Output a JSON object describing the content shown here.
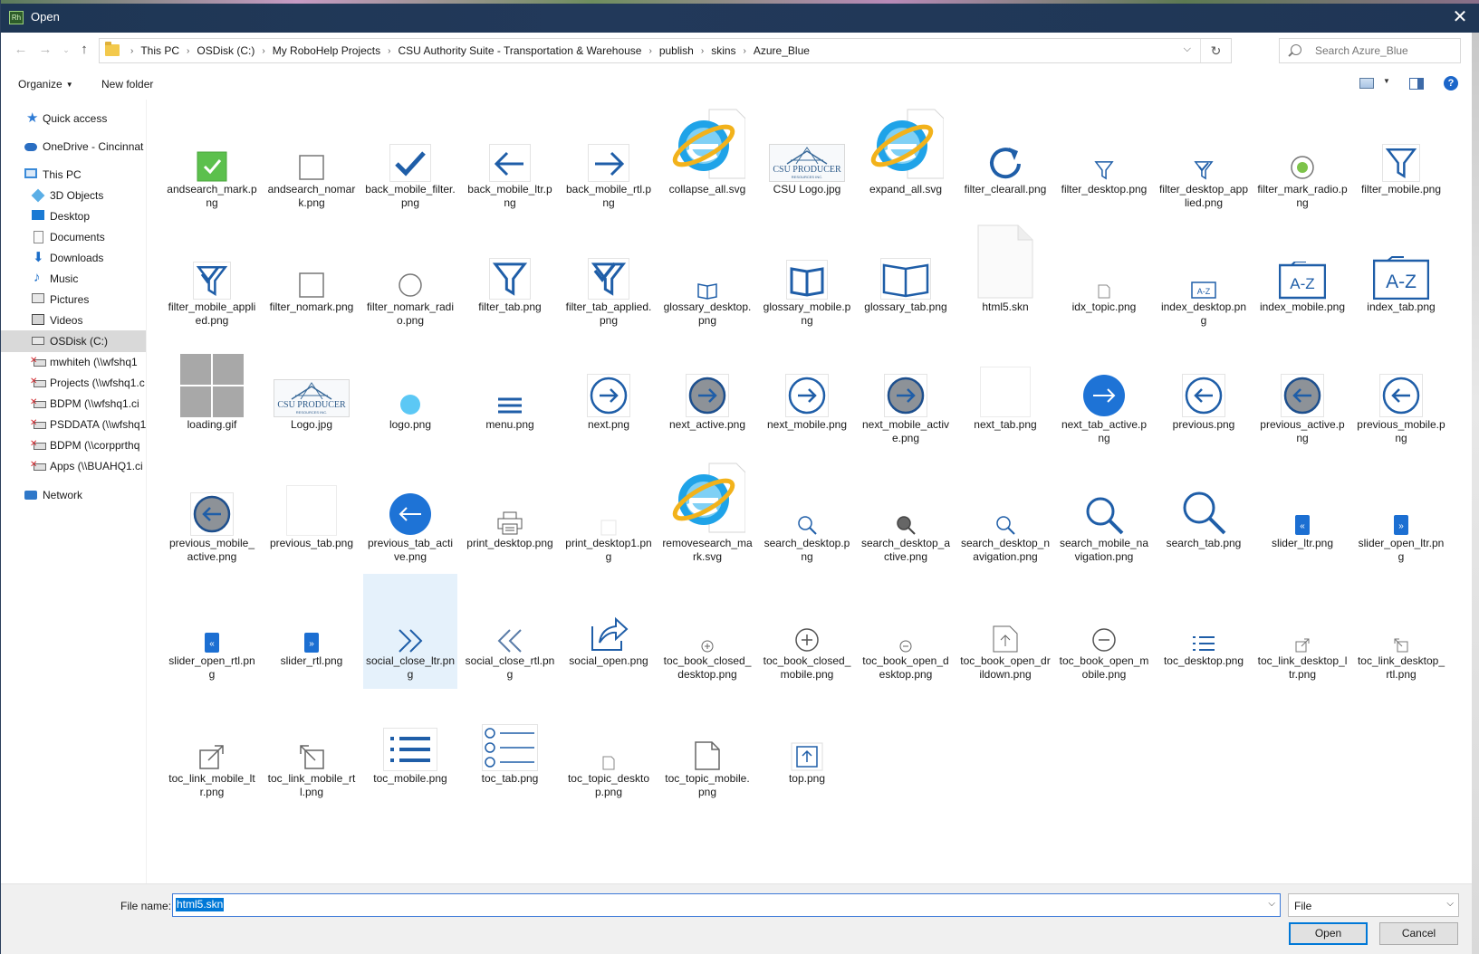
{
  "window": {
    "title": "Open",
    "app_icon_text": "Rh",
    "close_label": "✕"
  },
  "address": {
    "crumbs": [
      "This PC",
      "OSDisk (C:)",
      "My RoboHelp Projects",
      "CSU Authority Suite - Transportation & Warehouse",
      "publish",
      "skins",
      "Azure_Blue"
    ]
  },
  "search": {
    "placeholder": "Search Azure_Blue"
  },
  "toolbar": {
    "organize": "Organize",
    "new_folder": "New folder",
    "help": "?"
  },
  "nav": {
    "items": [
      {
        "label": "Quick access",
        "icon": "star-icon"
      },
      {
        "label": "OneDrive - Cincinnat",
        "icon": "cloud-icon"
      },
      {
        "label": "This PC",
        "icon": "computer-icon"
      },
      {
        "label": "3D Objects",
        "icon": "cube-icon"
      },
      {
        "label": "Desktop",
        "icon": "desktop-icon"
      },
      {
        "label": "Documents",
        "icon": "documents-icon"
      },
      {
        "label": "Downloads",
        "icon": "download-icon"
      },
      {
        "label": "Music",
        "icon": "music-icon"
      },
      {
        "label": "Pictures",
        "icon": "pictures-icon"
      },
      {
        "label": "Videos",
        "icon": "videos-icon"
      },
      {
        "label": "OSDisk (C:)",
        "icon": "drive-icon"
      },
      {
        "label": "mwhiteh (\\\\wfshq1",
        "icon": "network-drive-icon"
      },
      {
        "label": "Projects (\\\\wfshq1.c",
        "icon": "network-drive-icon"
      },
      {
        "label": "BDPM (\\\\wfshq1.ci",
        "icon": "network-drive-icon"
      },
      {
        "label": "PSDDATA (\\\\wfshq1",
        "icon": "network-drive-icon"
      },
      {
        "label": "BDPM (\\\\corpprthq",
        "icon": "network-drive-icon"
      },
      {
        "label": "Apps (\\\\BUAHQ1.ci",
        "icon": "network-drive-icon"
      },
      {
        "label": "Network",
        "icon": "network-icon"
      }
    ],
    "selected": "OSDisk (C:)"
  },
  "files": [
    {
      "name": "andsearch_mark.png",
      "icon": "green-check-box"
    },
    {
      "name": "andsearch_nomark.png",
      "icon": "empty-box"
    },
    {
      "name": "back_mobile_filter.png",
      "icon": "checkmark"
    },
    {
      "name": "back_mobile_ltr.png",
      "icon": "arrow-left"
    },
    {
      "name": "back_mobile_rtl.png",
      "icon": "arrow-right"
    },
    {
      "name": "collapse_all.svg",
      "icon": "ie-logo"
    },
    {
      "name": "CSU Logo.jpg",
      "icon": "csu-logo"
    },
    {
      "name": "expand_all.svg",
      "icon": "ie-logo"
    },
    {
      "name": "filter_clearall.png",
      "icon": "refresh"
    },
    {
      "name": "filter_desktop.png",
      "icon": "funnel-small"
    },
    {
      "name": "filter_desktop_applied.png",
      "icon": "funnel-check-small"
    },
    {
      "name": "filter_mark_radio.png",
      "icon": "radio-on"
    },
    {
      "name": "filter_mobile.png",
      "icon": "funnel"
    },
    {
      "name": "filter_mobile_applied.png",
      "icon": "funnel-check"
    },
    {
      "name": "filter_nomark.png",
      "icon": "empty-box"
    },
    {
      "name": "filter_nomark_radio.png",
      "icon": "radio-off"
    },
    {
      "name": "filter_tab.png",
      "icon": "funnel-large"
    },
    {
      "name": "filter_tab_applied.png",
      "icon": "funnel-check-large"
    },
    {
      "name": "glossary_desktop.png",
      "icon": "book-small"
    },
    {
      "name": "glossary_mobile.png",
      "icon": "book"
    },
    {
      "name": "glossary_tab.png",
      "icon": "book-large"
    },
    {
      "name": "html5.skn",
      "icon": "blank-doc"
    },
    {
      "name": "idx_topic.png",
      "icon": "doc-tiny"
    },
    {
      "name": "index_desktop.png",
      "icon": "az-small"
    },
    {
      "name": "index_mobile.png",
      "icon": "az"
    },
    {
      "name": "index_tab.png",
      "icon": "az-large"
    },
    {
      "name": "loading.gif",
      "icon": "gray-grid"
    },
    {
      "name": "Logo.jpg",
      "icon": "csu-logo"
    },
    {
      "name": "logo.png",
      "icon": "blue-dot"
    },
    {
      "name": "menu.png",
      "icon": "hamburger"
    },
    {
      "name": "next.png",
      "icon": "circle-arrow-right"
    },
    {
      "name": "next_active.png",
      "icon": "circle-arrow-right-gray"
    },
    {
      "name": "next_mobile.png",
      "icon": "circle-arrow-right"
    },
    {
      "name": "next_mobile_active.png",
      "icon": "circle-arrow-right-gray"
    },
    {
      "name": "next_tab.png",
      "icon": "white-square"
    },
    {
      "name": "next_tab_active.png",
      "icon": "circle-arrow-right-blue"
    },
    {
      "name": "previous.png",
      "icon": "circle-arrow-left"
    },
    {
      "name": "previous_active.png",
      "icon": "circle-arrow-left-gray"
    },
    {
      "name": "previous_mobile.png",
      "icon": "circle-arrow-left"
    },
    {
      "name": "previous_mobile_active.png",
      "icon": "circle-arrow-left-gray"
    },
    {
      "name": "previous_tab.png",
      "icon": "white-square"
    },
    {
      "name": "previous_tab_active.png",
      "icon": "circle-arrow-left-blue"
    },
    {
      "name": "print_desktop.png",
      "icon": "printer"
    },
    {
      "name": "print_desktop1.png",
      "icon": "white-tiny"
    },
    {
      "name": "removesearch_mark.svg",
      "icon": "ie-logo"
    },
    {
      "name": "search_desktop.png",
      "icon": "magnifier-small"
    },
    {
      "name": "search_desktop_active.png",
      "icon": "magnifier-dark-small"
    },
    {
      "name": "search_desktop_navigation.png",
      "icon": "magnifier-small"
    },
    {
      "name": "search_mobile_navigation.png",
      "icon": "magnifier"
    },
    {
      "name": "search_tab.png",
      "icon": "magnifier-large"
    },
    {
      "name": "slider_ltr.png",
      "icon": "slider-left"
    },
    {
      "name": "slider_open_ltr.png",
      "icon": "slider-right"
    },
    {
      "name": "slider_open_rtl.png",
      "icon": "slider-left"
    },
    {
      "name": "slider_rtl.png",
      "icon": "slider-right"
    },
    {
      "name": "social_close_ltr.png",
      "icon": "double-chevron-right"
    },
    {
      "name": "social_close_rtl.png",
      "icon": "double-chevron-left"
    },
    {
      "name": "social_open.png",
      "icon": "share-arrow"
    },
    {
      "name": "toc_book_closed_desktop.png",
      "icon": "plus-circle-small"
    },
    {
      "name": "toc_book_closed_mobile.png",
      "icon": "plus-circle"
    },
    {
      "name": "toc_book_open_desktop.png",
      "icon": "minus-circle-small"
    },
    {
      "name": "toc_book_open_drildown.png",
      "icon": "doc-up"
    },
    {
      "name": "toc_book_open_mobile.png",
      "icon": "minus-circle"
    },
    {
      "name": "toc_desktop.png",
      "icon": "list-small"
    },
    {
      "name": "toc_link_desktop_ltr.png",
      "icon": "link-out-small"
    },
    {
      "name": "toc_link_desktop_rtl.png",
      "icon": "link-in-small"
    },
    {
      "name": "toc_link_mobile_ltr.png",
      "icon": "link-out"
    },
    {
      "name": "toc_link_mobile_rtl.png",
      "icon": "link-in"
    },
    {
      "name": "toc_mobile.png",
      "icon": "list"
    },
    {
      "name": "toc_tab.png",
      "icon": "list-circles"
    },
    {
      "name": "toc_topic_desktop.png",
      "icon": "doc-tiny"
    },
    {
      "name": "toc_topic_mobile.png",
      "icon": "doc"
    },
    {
      "name": "top.png",
      "icon": "up-box"
    }
  ],
  "selected_file": "social_close_ltr.png",
  "filename": {
    "label": "File name:",
    "value": "html5.skn"
  },
  "filetype": {
    "value": "File"
  },
  "buttons": {
    "open": "Open",
    "cancel": "Cancel"
  },
  "colors": {
    "title_bar": "#1f3655",
    "accent": "#0078d7",
    "icon_blue": "#1f5ea8",
    "selection": "#e5f1fb"
  }
}
